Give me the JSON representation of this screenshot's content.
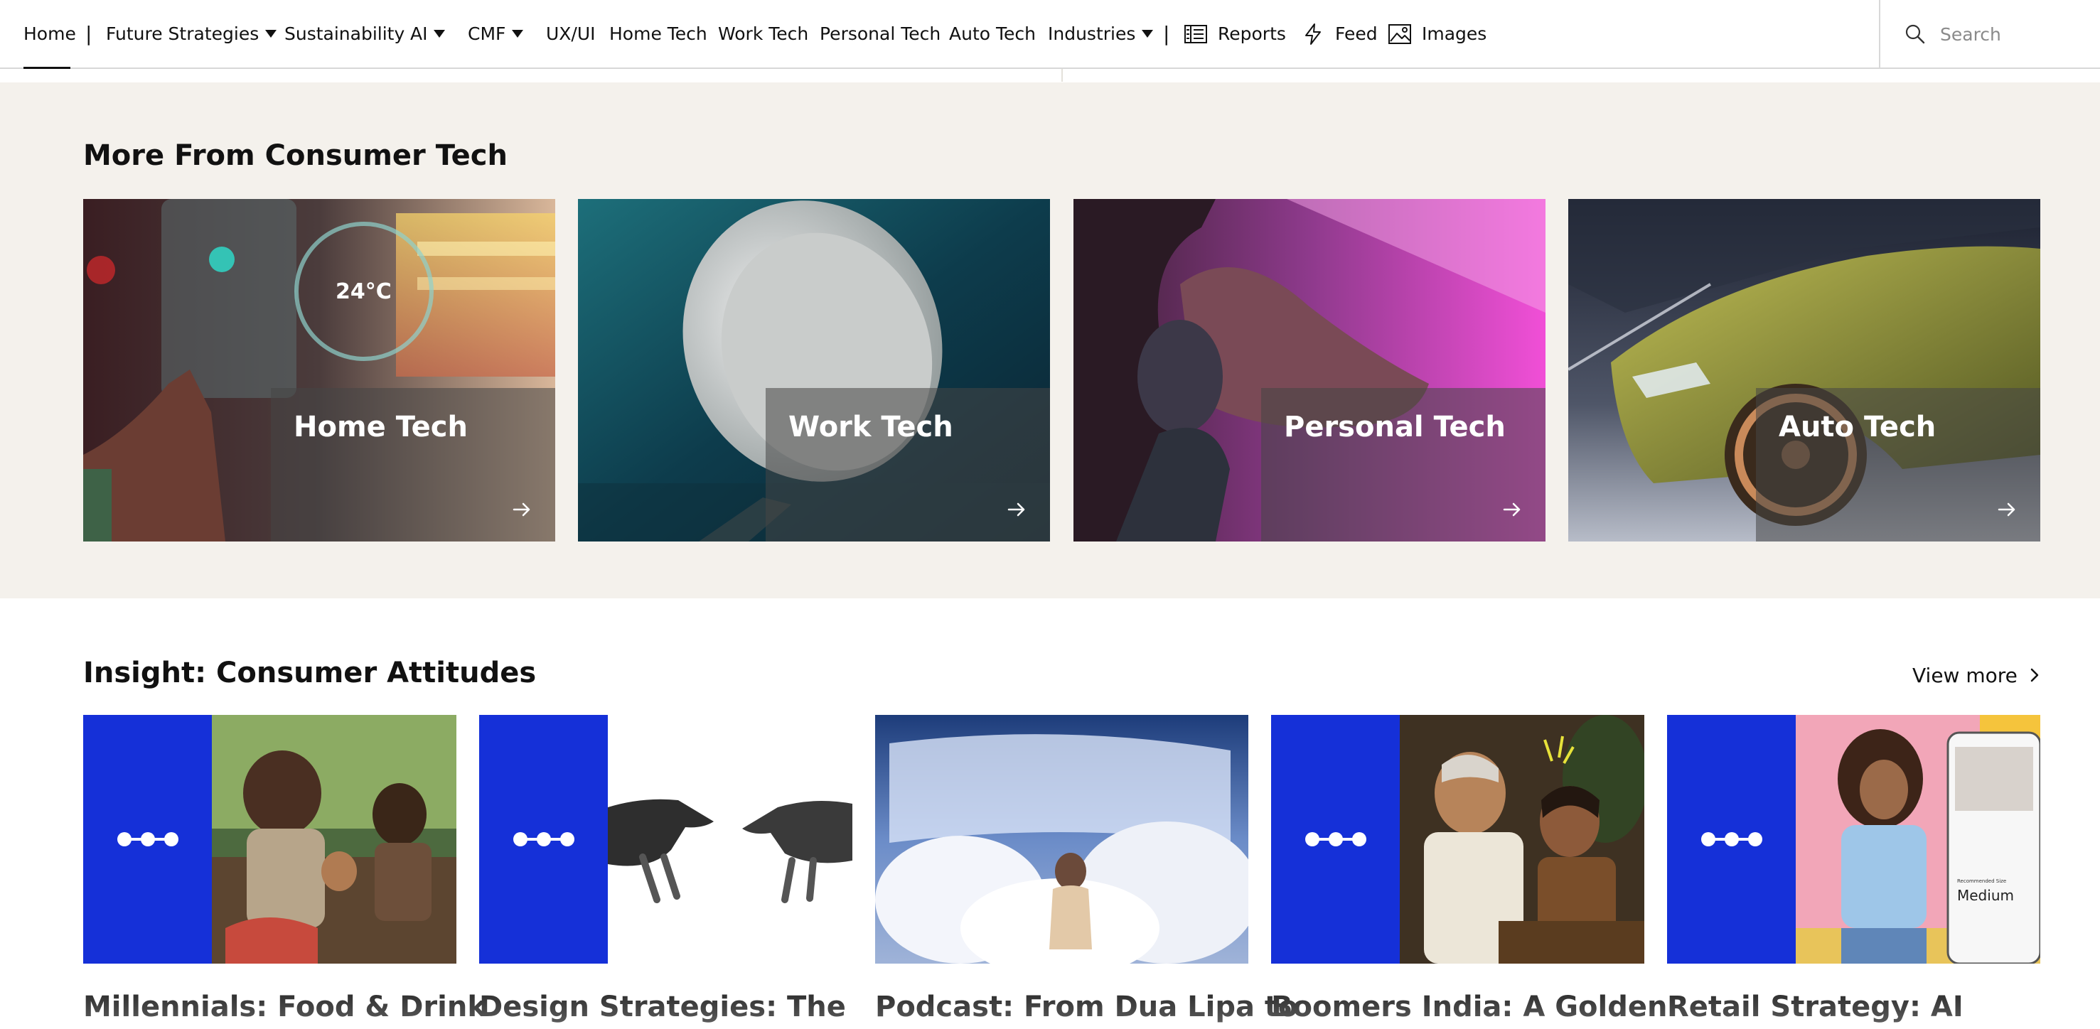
{
  "nav": {
    "items": [
      {
        "label": "Home",
        "active": true
      },
      {
        "label": "Future Strategies",
        "dropdown": true
      },
      {
        "label": "Sustainability"
      },
      {
        "label": "AI",
        "dropdown": true
      },
      {
        "label": "CMF",
        "dropdown": true
      },
      {
        "label": "UX/UI"
      },
      {
        "label": "Home Tech"
      },
      {
        "label": "Work Tech"
      },
      {
        "label": "Personal Tech"
      },
      {
        "label": "Auto Tech"
      },
      {
        "label": "Industries",
        "dropdown": true
      }
    ],
    "separator": "|",
    "utility": [
      {
        "label": "Reports",
        "icon": "reports-icon"
      },
      {
        "label": "Feed",
        "icon": "lightning-icon"
      },
      {
        "label": "Images",
        "icon": "image-icon"
      }
    ],
    "search": {
      "placeholder": "Search",
      "icon": "search-icon"
    }
  },
  "more_section": {
    "title": "More From Consumer Tech",
    "cards": [
      {
        "label": "Home Tech",
        "image": "smart-home-thermostat-panel"
      },
      {
        "label": "Work Tech",
        "image": "white-speaker-device"
      },
      {
        "label": "Personal Tech",
        "image": "woman-with-headphones"
      },
      {
        "label": "Auto Tech",
        "image": "green-sports-car"
      }
    ]
  },
  "insight_section": {
    "title": "Insight: Consumer Attitudes",
    "view_more": "View more",
    "cards": [
      {
        "title": "Millennials: Food & Drink",
        "image": "family-eating-outdoors",
        "badge": true
      },
      {
        "title": "Design Strategies: The",
        "image": "two-hands-reaching",
        "badge": true
      },
      {
        "title": "Podcast: From Dua Lipa to",
        "image": "singer-on-stage-feathers",
        "badge": false
      },
      {
        "title": "Boomers India: A Golden",
        "image": "couple-playing-chess",
        "badge": true
      },
      {
        "title": "Retail Strategy: AI",
        "image": "woman-with-phone-app",
        "badge": true
      },
      {
        "recommended_label": "Recommended Size",
        "size_value": "Medium"
      }
    ]
  },
  "colors": {
    "accent_blue": "#1530d8",
    "section_bg": "#f4f1ec"
  }
}
